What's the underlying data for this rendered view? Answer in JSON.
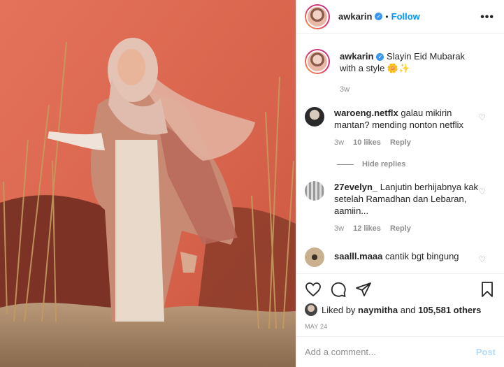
{
  "post": {
    "username": "awkarin",
    "dot": "•",
    "follow_label": "Follow",
    "more_label": "•••"
  },
  "caption": {
    "username": "awkarin",
    "text": "Slayin Eid Mubarak with a style 🌼✨",
    "time": "3w"
  },
  "comments": [
    {
      "username": "waroeng.netflx",
      "text": "galau mikirin mantan? mending nonton netflix",
      "time": "3w",
      "likes": "10 likes",
      "reply": "Reply"
    },
    {
      "username": "27evelyn_",
      "text": "Lanjutin berhijabnya kak setelah Ramadhan dan Lebaran, aamiin...",
      "time": "3w",
      "likes": "12 likes",
      "reply": "Reply"
    },
    {
      "username": "saalll.maaa",
      "text": "cantik bgt bingung"
    }
  ],
  "hide_replies": "Hide replies",
  "likes": {
    "prefix": "Liked by",
    "user": "naymitha",
    "and": "and",
    "count": "105,581 others"
  },
  "date": "MAY 24",
  "add_comment": {
    "placeholder": "Add a comment...",
    "post_label": "Post"
  },
  "colors": {
    "accent": "#0095f6",
    "verified": "#3897f0",
    "muted": "#8e8e8e",
    "post_disabled": "#b3dbff"
  },
  "icons": [
    "heart-icon",
    "comment-icon",
    "share-icon",
    "bookmark-icon",
    "verified-icon",
    "more-icon"
  ]
}
